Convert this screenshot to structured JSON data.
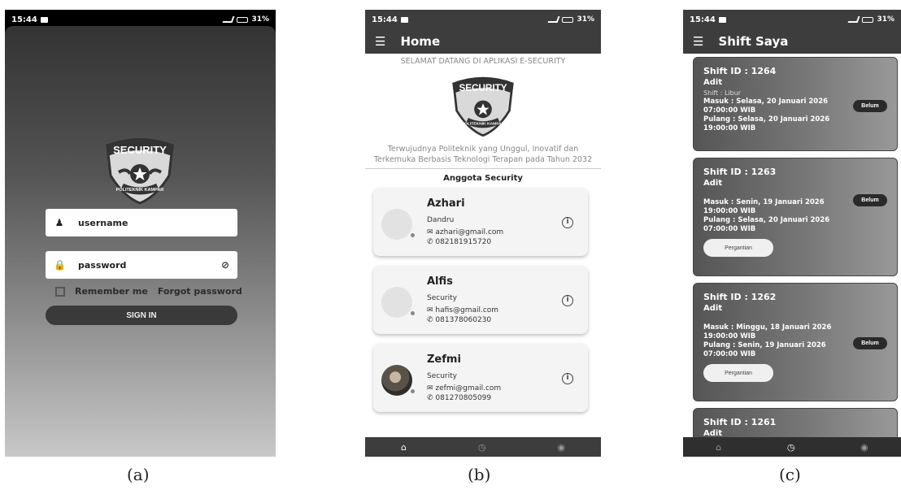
{
  "status_bar": {
    "time": "15:44",
    "battery": "31%"
  },
  "login": {
    "username_placeholder": "username",
    "password_placeholder": "password",
    "remember_label": "Remember me",
    "forgot_label": "Forgot password",
    "sign_in_label": "SIGN IN"
  },
  "logo": {
    "top_text": "SECURITY",
    "bottom_text": "POLITEKNIK KAMPAR"
  },
  "home": {
    "title": "Home",
    "welcome": "SELAMAT DATANG DI APLIKASI E-SECURITY",
    "vision": "Terwujudnya Politeknik yang Unggul, Inovatif dan Terkemuka Berbasis Teknologi Terapan pada Tahun 2032",
    "members_title": "Anggota Security",
    "members": [
      {
        "name": "Azhari",
        "role": "Dandru",
        "email": "azhari@gmail.com",
        "phone": "082181915720"
      },
      {
        "name": "Alfis",
        "role": "Security",
        "email": "hafis@gmail.com",
        "phone": "081378060230"
      },
      {
        "name": "Zefmi",
        "role": "Security",
        "email": "zefmi@gmail.com",
        "phone": "081270805099"
      }
    ]
  },
  "shift": {
    "title": "Shift Saya",
    "status_label": "Belum",
    "swap_label": "Pergantian",
    "cards": [
      {
        "id": "Shift ID : 1264",
        "name": "Adit",
        "type": "Shift : Libur",
        "masuk": "Masuk : Selasa, 20 Januari 2026",
        "masuk_time": "07:00:00 WIB",
        "pulang": "Pulang : Selasa, 20 Januari 2026",
        "pulang_time": "19:00:00 WIB"
      },
      {
        "id": "Shift ID : 1263",
        "name": "Adit",
        "type": "",
        "masuk": "Masuk : Senin, 19 Januari 2026",
        "masuk_time": "19:00:00 WIB",
        "pulang": "Pulang : Selasa, 20 Januari 2026",
        "pulang_time": "07:00:00 WIB"
      },
      {
        "id": "Shift ID : 1262",
        "name": "Adit",
        "type": "",
        "masuk": "Masuk : Minggu, 18 Januari 2026",
        "masuk_time": "19:00:00 WIB",
        "pulang": "Pulang : Senin, 19 Januari 2026",
        "pulang_time": "07:00:00 WIB"
      },
      {
        "id": "Shift ID : 1261",
        "name": "Adit"
      }
    ]
  },
  "captions": {
    "a": "(a)",
    "b": "(b)",
    "c": "(c)"
  }
}
